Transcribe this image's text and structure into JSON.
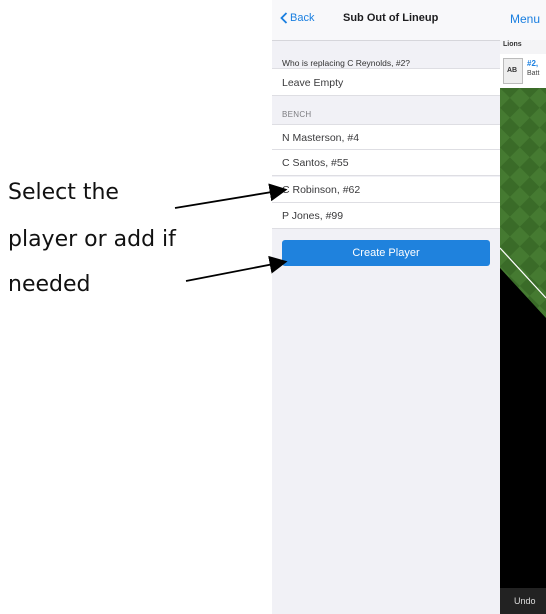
{
  "annotation": {
    "line1": "Select the",
    "line2": "player or add if",
    "line3": "needed"
  },
  "subPanel": {
    "back_label": "Back",
    "title": "Sub Out of Lineup",
    "question": "Who is replacing C Reynolds, #2?",
    "leave_empty": "Leave Empty",
    "bench_header": "BENCH",
    "bench": [
      {
        "label": "N Masterson, #4"
      },
      {
        "label": "C Santos, #55"
      },
      {
        "label": "C Robinson, #62"
      },
      {
        "label": "P Jones, #99"
      }
    ],
    "create_button": "Create Player"
  },
  "game": {
    "menu_label": "Menu",
    "team": "Lions",
    "at_bat_label": "AB",
    "batter_number": "#2,",
    "batter_label": "Batt",
    "undo_label": "Undo"
  },
  "colors": {
    "accent": "#1f82dd",
    "field_green": "#3d6e2a",
    "panel_bg": "#f1f1f6"
  }
}
